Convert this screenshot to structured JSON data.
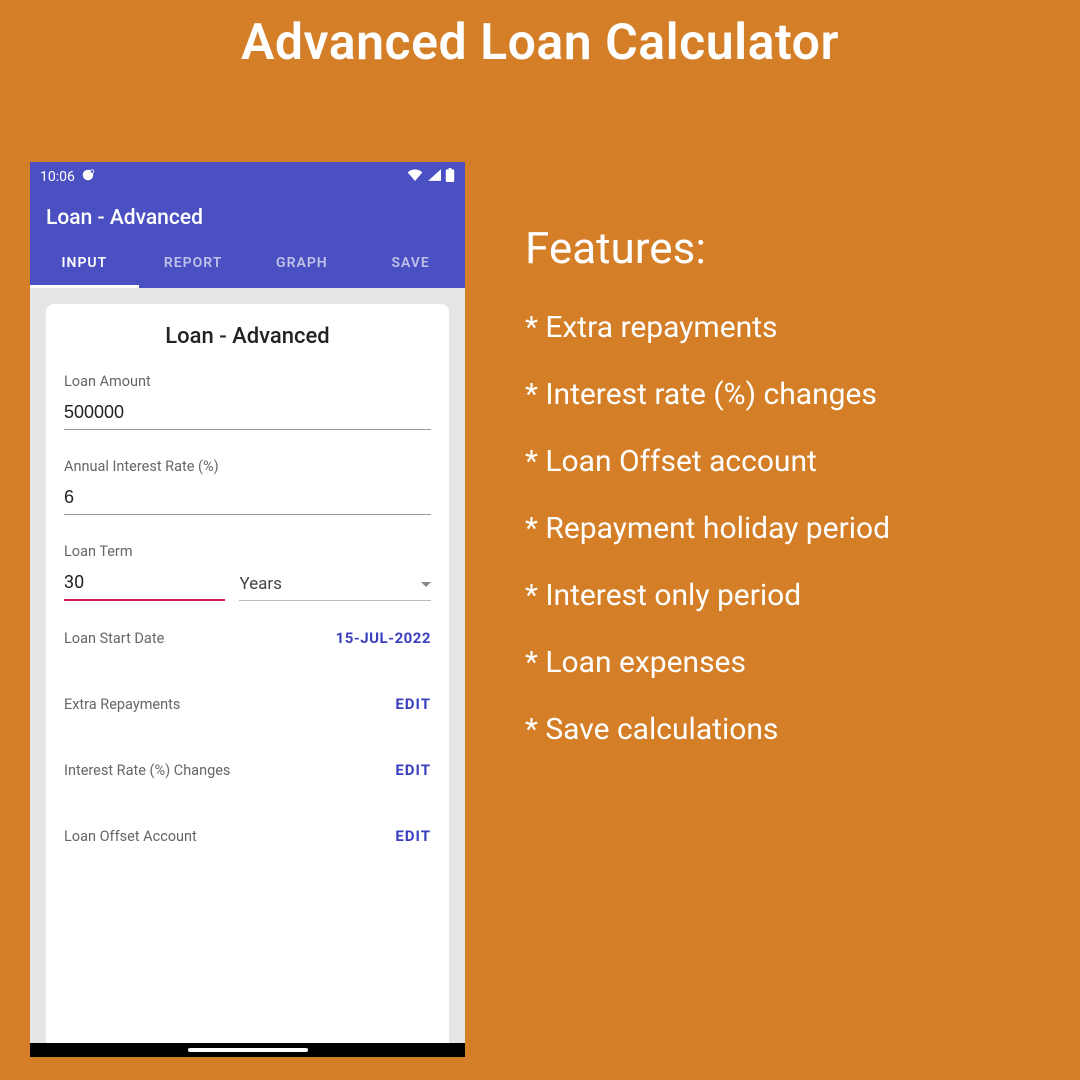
{
  "page": {
    "title": "Advanced Loan Calculator"
  },
  "phone": {
    "status": {
      "time": "10:06"
    },
    "appbar": {
      "title": "Loan - Advanced"
    },
    "tabs": [
      {
        "label": "INPUT",
        "active": true
      },
      {
        "label": "REPORT",
        "active": false
      },
      {
        "label": "GRAPH",
        "active": false
      },
      {
        "label": "SAVE",
        "active": false
      }
    ],
    "card": {
      "title": "Loan - Advanced",
      "loan_amount_label": "Loan Amount",
      "loan_amount_value": "500000",
      "interest_rate_label": "Annual Interest Rate (%)",
      "interest_rate_value": "6",
      "loan_term_label": "Loan Term",
      "loan_term_value": "30",
      "loan_term_unit": "Years",
      "start_date_label": "Loan Start Date",
      "start_date_value": "15-JUL-2022",
      "extra_repayments_label": "Extra Repayments",
      "rate_changes_label": "Interest Rate (%) Changes",
      "offset_label": "Loan Offset Account",
      "edit_text": "EDIT"
    }
  },
  "features": {
    "heading": "Features:",
    "items": [
      "* Extra repayments",
      "* Interest rate (%) changes",
      "* Loan Offset account",
      "* Repayment holiday period",
      "* Interest only period",
      "* Loan expenses",
      "* Save calculations"
    ]
  }
}
